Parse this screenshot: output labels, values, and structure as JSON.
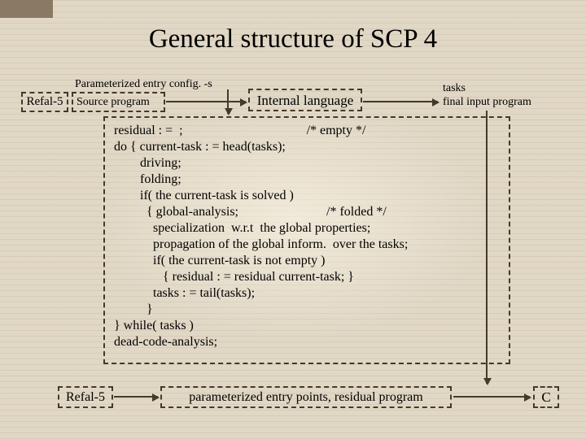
{
  "title": "General structure of SCP 4",
  "input": {
    "refal_label": "Refal-5",
    "param_label": "Parameterized entry config. -s",
    "source_label": "Source program",
    "internal_lang": "Internal language",
    "tasks_line1": "tasks",
    "tasks_line2": "final input program"
  },
  "pseudo": {
    "code": "residual : =  ;                                      /* empty */\ndo { current-task : = head(tasks);\n        driving;\n        folding;\n        if( the current-task is solved )\n          { global-analysis;                           /* folded */\n            specialization  w.r.t  the global properties;\n            propagation of the global inform.  over the tasks;\n            if( the current-task is not empty )\n               { residual : = residual current-task; }\n            tasks : = tail(tasks);\n          }\n} while( tasks )\ndead-code-analysis;"
  },
  "output": {
    "refal_label": "Refal-5",
    "residual_label": "parameterized entry points, residual program",
    "c_label": "C"
  }
}
